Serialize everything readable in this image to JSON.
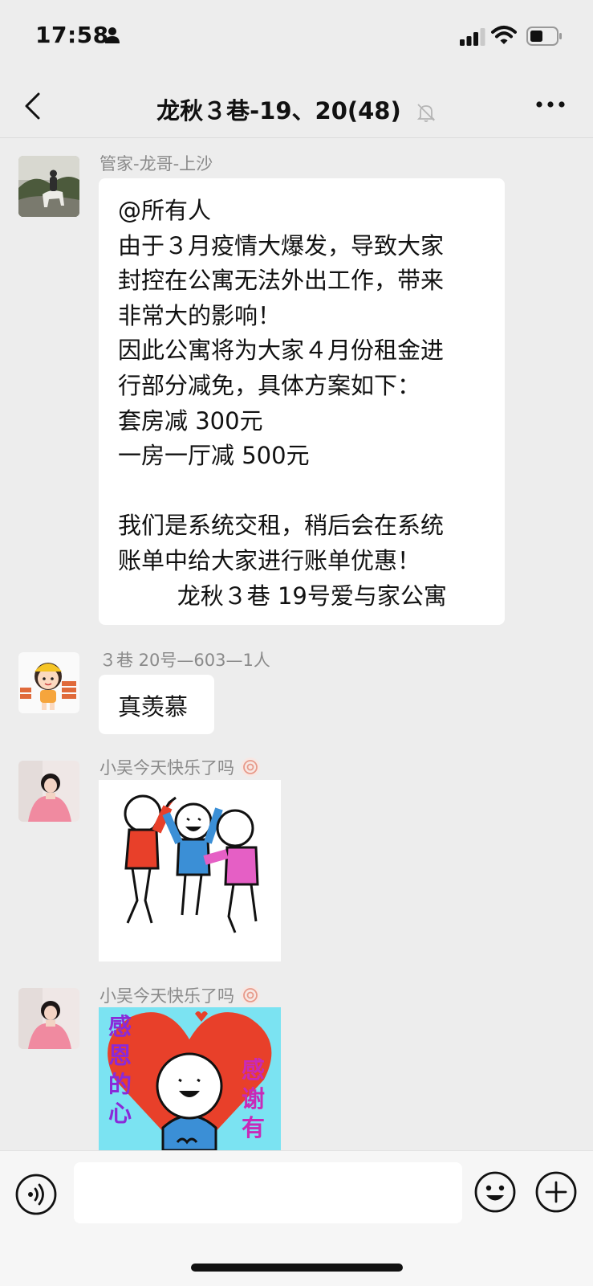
{
  "status": {
    "time": "17:58"
  },
  "chat": {
    "title": "龙秋３巷-19、20(48)"
  },
  "messages": [
    {
      "sender": "管家-龙哥-上沙",
      "text": "@所有人\n由于３月疫情大爆发，导致大家\n封控在公寓无法外出工作，带来\n非常大的影响！\n因此公寓将为大家４月份租金进\n行部分减免，具体方案如下：\n套房减 300元\n一房一厅减 500元\n\n我们是系统交租，稍后会在系统\n账单中给大家进行账单优惠！\n        龙秋３巷 19号爱与家公寓"
    },
    {
      "sender": "３巷 20号—603—1人",
      "text": "真羡慕"
    },
    {
      "sender": "小吴今天快乐了吗"
    },
    {
      "sender": "小吴今天快乐了吗",
      "sticker_left": "感恩的心",
      "sticker_right": "感谢有"
    }
  ],
  "icons": {
    "accent": "#07c160",
    "sticker_red": "#e8402a",
    "sticker_blue": "#3b8fd6",
    "sticker_pink": "#e55fc5",
    "sticker_cyan": "#7be3f2"
  }
}
